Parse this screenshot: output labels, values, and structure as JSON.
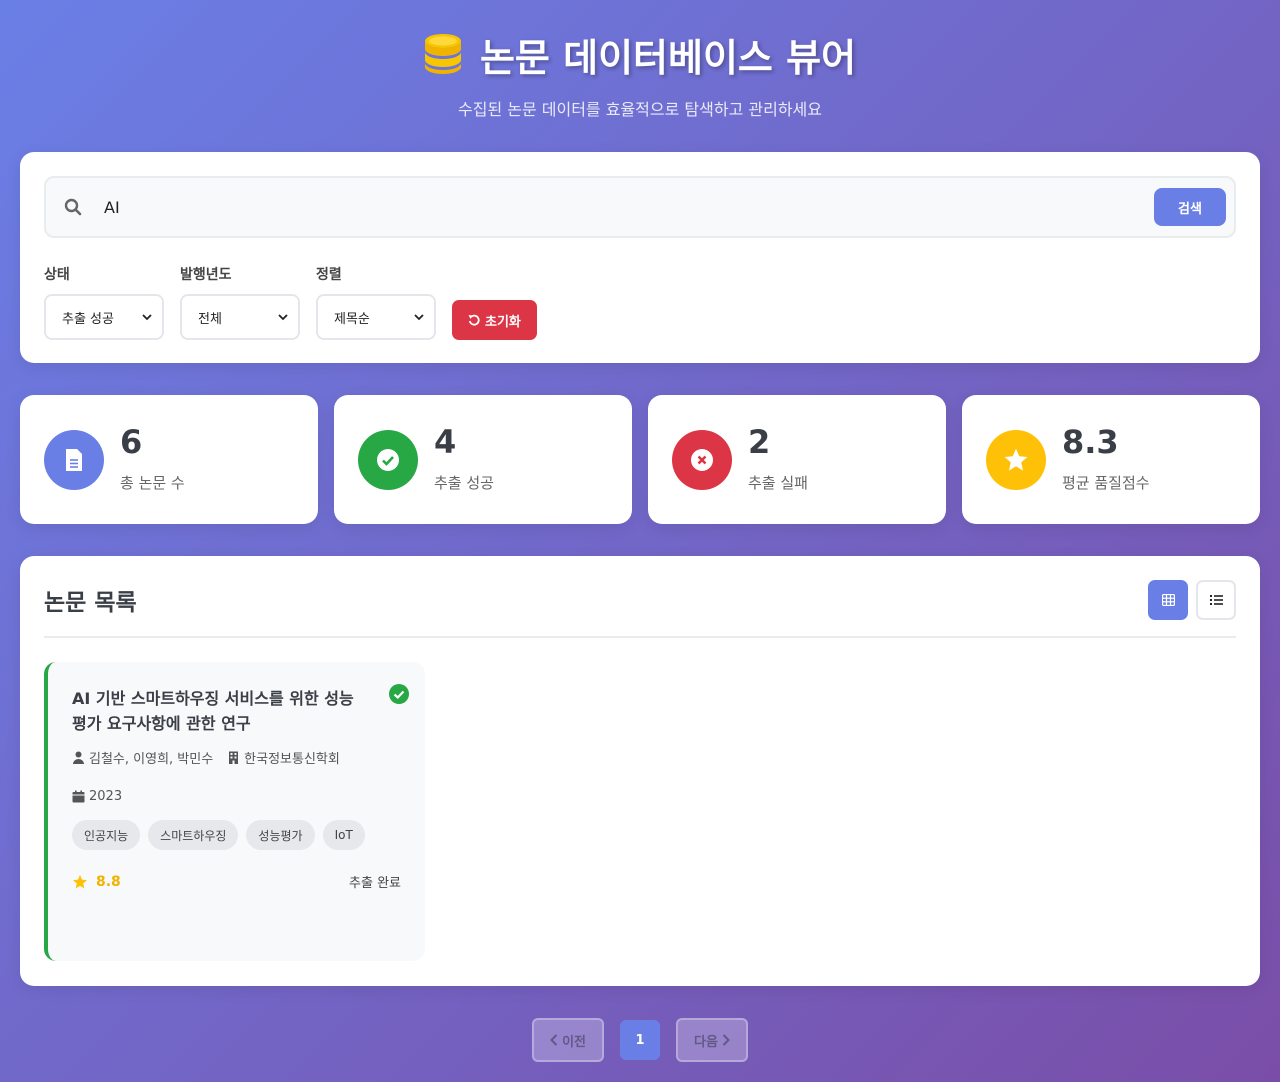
{
  "header": {
    "title": "논문 데이터베이스 뷰어",
    "subtitle": "수집된 논문 데이터를 효율적으로 탐색하고 관리하세요"
  },
  "search": {
    "value": "AI",
    "button_label": "검색"
  },
  "filters": {
    "status": {
      "label": "상태",
      "selected": "추출 성공"
    },
    "year": {
      "label": "발행년도",
      "selected": "전체"
    },
    "sort": {
      "label": "정렬",
      "selected": "제목순"
    },
    "reset_label": "초기화"
  },
  "stats": [
    {
      "value": "6",
      "label": "총 논문 수",
      "color": "#6a7fe6",
      "icon": "file-icon"
    },
    {
      "value": "4",
      "label": "추출 성공",
      "color": "#28a745",
      "icon": "check-circle-icon"
    },
    {
      "value": "2",
      "label": "추출 실패",
      "color": "#dc3545",
      "icon": "x-circle-icon"
    },
    {
      "value": "8.3",
      "label": "평균 품질점수",
      "color": "#ffc107",
      "icon": "star-icon"
    }
  ],
  "list": {
    "title": "논문 목록",
    "papers": [
      {
        "title": "AI 기반 스마트하우징 서비스를 위한 성능 평가 요구사항에 관한 연구",
        "authors": "김철수, 이영희, 박민수",
        "publisher": "한국정보통신학회",
        "year": "2023",
        "tags": [
          "인공지능",
          "스마트하우징",
          "성능평가",
          "IoT"
        ],
        "score": "8.8",
        "status": "추출 완료"
      }
    ]
  },
  "pagination": {
    "prev_label": "이전",
    "current_page": "1",
    "next_label": "다음"
  },
  "colors": {
    "accent": "#6a7fe6",
    "success": "#28a745",
    "danger": "#dc3545",
    "warning": "#ffc107"
  }
}
